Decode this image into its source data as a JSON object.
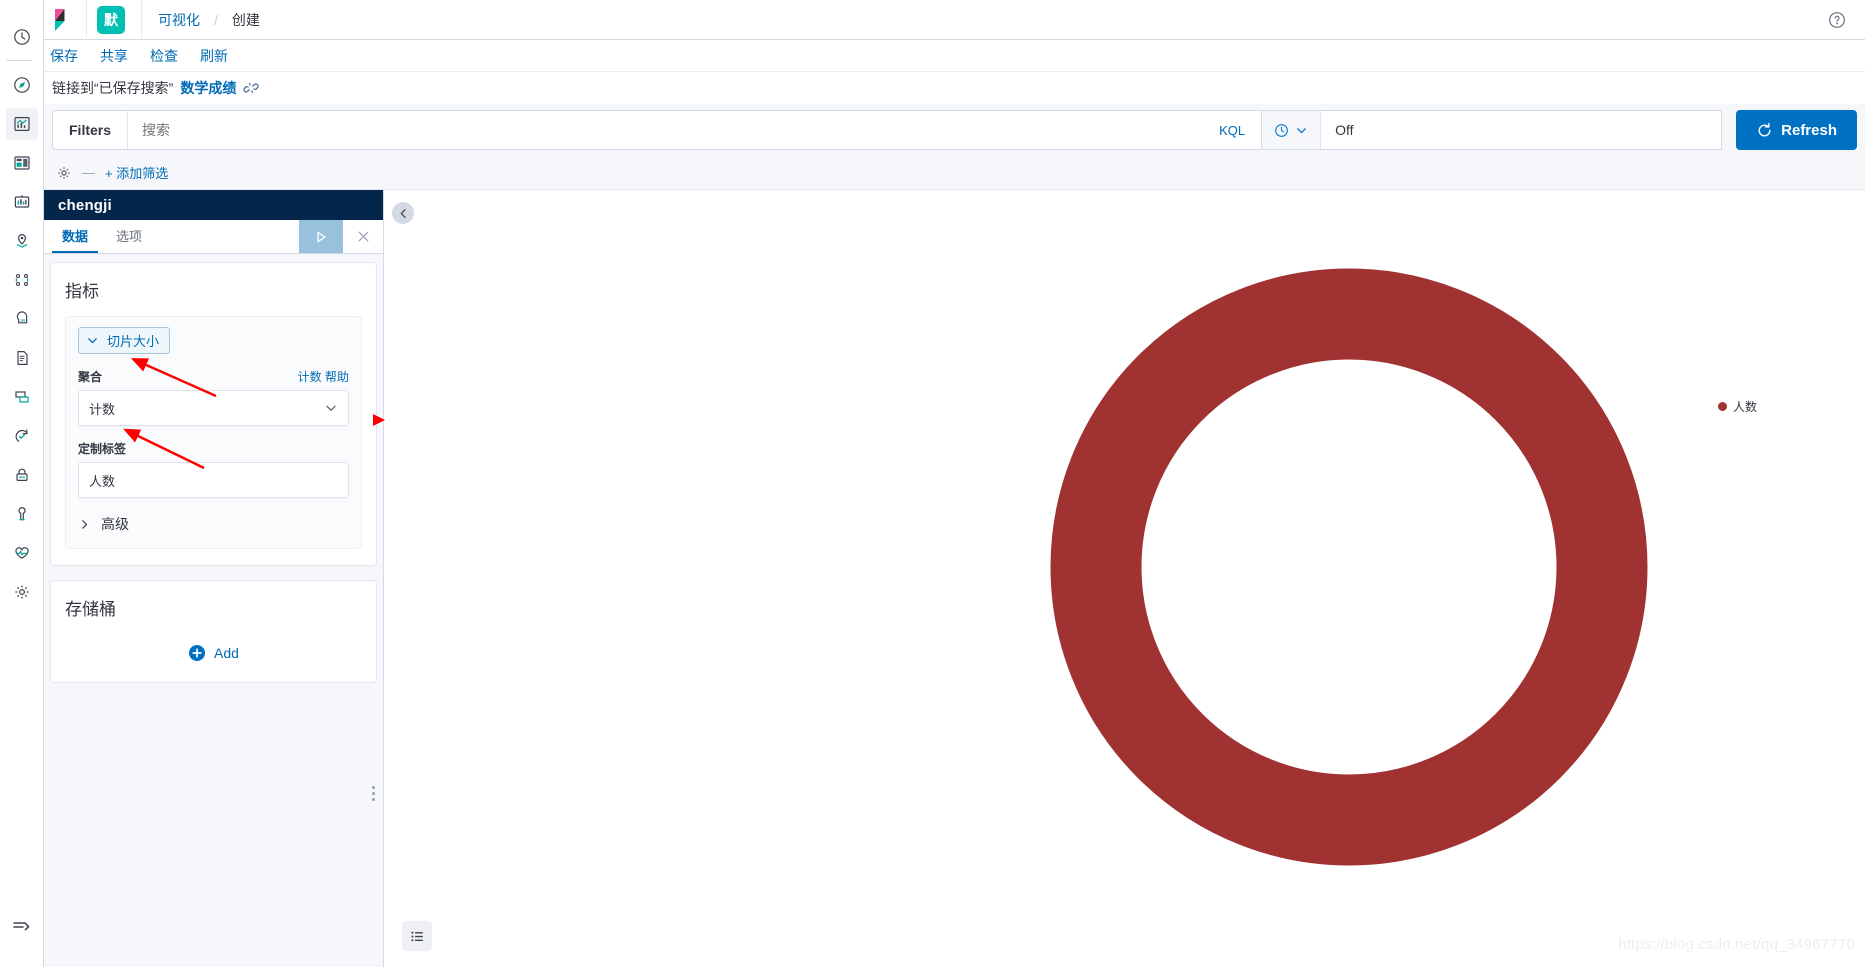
{
  "header": {
    "logo": "kibana-logo",
    "space_badge": "默",
    "breadcrumbs": [
      {
        "label": "可视化",
        "current": false
      },
      {
        "label": "创建",
        "current": true
      }
    ],
    "breadcrumb_separator": "/",
    "help_icon": "help-circle-icon"
  },
  "actions": [
    {
      "label": "保存",
      "name": "save"
    },
    {
      "label": "共享",
      "name": "share"
    },
    {
      "label": "检查",
      "name": "inspect"
    },
    {
      "label": "刷新",
      "name": "refresh"
    }
  ],
  "linked_search": {
    "text": "链接到“已保存搜索”",
    "name": "数学成绩",
    "unlink_icon": "broken-link-icon"
  },
  "query_bar": {
    "filters_label": "Filters",
    "search_value": "",
    "search_placeholder": "搜索",
    "kql_label": "KQL",
    "time_icon": "clock-icon",
    "time_chevron": "chevron-down-icon",
    "time_value": "Off",
    "refresh_label": "Refresh",
    "refresh_icon": "refresh-icon"
  },
  "filter_row": {
    "settings_icon": "gear-icon",
    "dash": "—",
    "add_filter_label": "+ 添加筛选"
  },
  "sidebar": {
    "items": [
      {
        "icon": "recently-viewed-clock-icon",
        "active": false
      },
      {
        "icon": "discover-compass-icon",
        "active": false
      },
      {
        "icon": "visualize-chart-icon",
        "active": true
      },
      {
        "icon": "dashboard-icon",
        "active": false
      },
      {
        "icon": "canvas-icon",
        "active": false
      },
      {
        "icon": "maps-pin-icon",
        "active": false
      },
      {
        "icon": "graph-icon",
        "active": false
      },
      {
        "icon": "machine-learning-icon",
        "active": false
      },
      {
        "icon": "logs-document-icon",
        "active": false
      },
      {
        "icon": "metrics-icon",
        "active": false
      },
      {
        "icon": "uptime-icon",
        "active": false
      },
      {
        "icon": "security-lock-icon",
        "active": false
      },
      {
        "icon": "dev-tools-wrench-icon",
        "active": false
      },
      {
        "icon": "monitoring-heartbeat-icon",
        "active": false
      },
      {
        "icon": "management-gear-icon",
        "active": false
      }
    ],
    "collapse_icon": "collapse-arrow-icon"
  },
  "editor": {
    "title": "chengji",
    "tabs": [
      {
        "label": "数据",
        "active": true
      },
      {
        "label": "选项",
        "active": false
      }
    ],
    "apply_icon": "play-apply-icon",
    "close_icon": "close-x-icon",
    "metrics": {
      "heading": "指标",
      "slice_size_label": "切片大小",
      "slice_size_chevron": "chevron-down-icon",
      "aggregation_label": "聚合",
      "aggregation_help": "计数 帮助",
      "aggregation_value": "计数",
      "aggregation_chevron": "chevron-down-icon",
      "custom_label_label": "定制标签",
      "custom_label_value": "人数",
      "advanced_label": "高级",
      "advanced_chevron": "chevron-right-icon"
    },
    "buckets": {
      "heading": "存储桶",
      "add_label": "Add",
      "add_icon": "plus-circle-icon"
    },
    "drag_handle": "panel-drag-handle"
  },
  "chart_data": {
    "type": "pie",
    "variant": "donut",
    "title": "",
    "legend_position": "top-right",
    "legend": [
      {
        "name": "人数",
        "color": "#a03232"
      }
    ],
    "slices": [
      {
        "label": "人数",
        "value": 100,
        "percent": 100,
        "color": "#a03232"
      }
    ],
    "total": 100,
    "inner_radius_ratio": 0.72
  },
  "chart_panel": {
    "collapse_icon": "chevron-left-icon",
    "table_toggle_icon": "data-table-icon"
  },
  "annotations": {
    "color": "#ff0000",
    "marker_icon": "red-triangle-marker",
    "arrows": [
      {
        "name": "arrow-to-aggregation"
      },
      {
        "name": "arrow-to-custom-label"
      }
    ]
  },
  "watermark": "https://blog.csdn.net/qq_34967770",
  "colors": {
    "brand_blue": "#006bb4",
    "refresh_blue": "#0071c2",
    "panel_navy": "#05264b",
    "space_teal": "#00bfb3",
    "donut_red": "#a03232"
  }
}
